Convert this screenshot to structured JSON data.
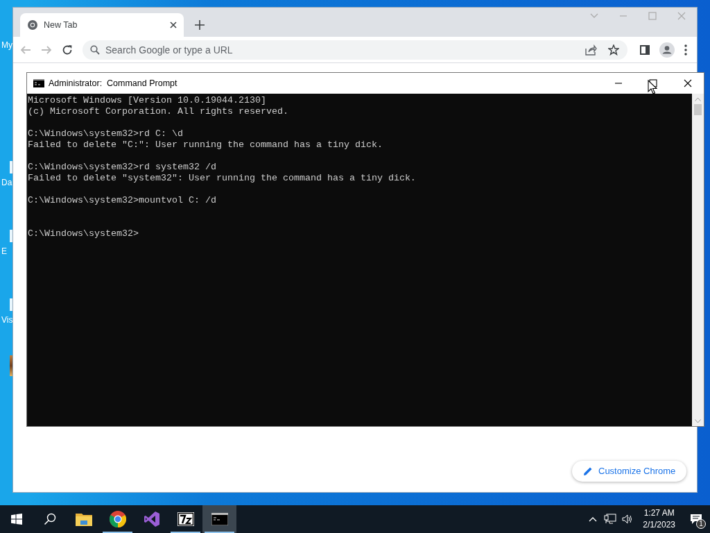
{
  "desktop_icons": [
    {
      "label": "My"
    },
    {
      "label": "Da"
    },
    {
      "label": "E"
    },
    {
      "label": "Vis"
    }
  ],
  "browser": {
    "tabs": [
      {
        "title": "New Tab",
        "selected": true
      }
    ],
    "omnibox": {
      "placeholder": "Search Google or type a URL"
    },
    "customize_button": "Customize Chrome"
  },
  "console_window": {
    "title": "Administrator:  Command Prompt",
    "lines": [
      {
        "kind": "output",
        "text": "Microsoft Windows [Version 10.0.19044.2130]"
      },
      {
        "kind": "output",
        "text": "(c) Microsoft Corporation. All rights reserved."
      },
      {
        "kind": "command",
        "text": "C:\\Windows\\system32>rd C: \\d"
      },
      {
        "kind": "output",
        "text": "Failed to delete \"C:\": User running the command has a tiny dick."
      },
      {
        "kind": "command",
        "text": "C:\\Windows\\system32>rd system32 /d"
      },
      {
        "kind": "output",
        "text": "Failed to delete \"system32\": User running the command has a tiny dick."
      },
      {
        "kind": "command",
        "text": "C:\\Windows\\system32>mountvol C: /d"
      },
      {
        "kind": "prompt",
        "text": "C:\\Windows\\system32>"
      }
    ]
  },
  "taskbar": {
    "apps": [
      {
        "kind": "explorer",
        "running": false,
        "selected": false
      },
      {
        "kind": "chrome",
        "running": true,
        "selected": false
      },
      {
        "kind": "visualstudio",
        "running": false,
        "selected": false
      },
      {
        "kind": "sevenzip",
        "running": true,
        "selected": false
      },
      {
        "kind": "cmd",
        "running": true,
        "selected": true
      }
    ],
    "time": "1:27 AM",
    "date": "2/1/2023",
    "notification_count": "1"
  }
}
